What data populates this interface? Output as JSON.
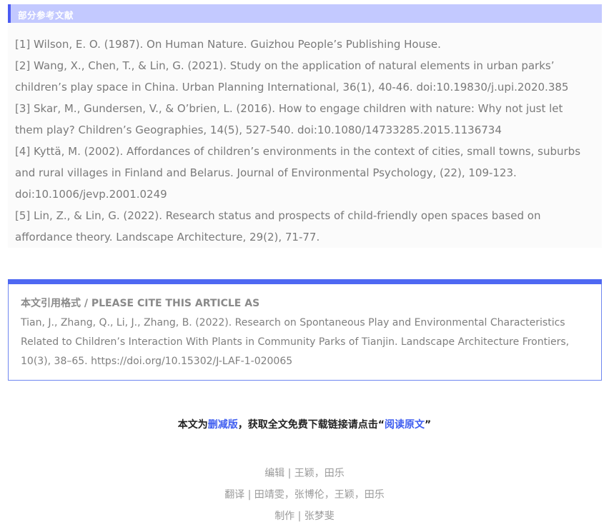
{
  "references": {
    "header": "部分参考文献",
    "items": [
      "[1] Wilson, E. O. (1987). On Human Nature. Guizhou People’s Publishing House.",
      "[2] Wang, X., Chen, T., & Lin, G. (2021). Study on the application of natural elements in urban parks’ children’s play space in China. Urban Planning International, 36(1), 40-46. doi:10.19830/j.upi.2020.385",
      "[3] Skar, M., Gundersen, V., & O’brien, L. (2016). How to engage children with nature: Why not just let them play? Children’s Geographies, 14(5), 527-540. doi:10.1080/14733285.2015.1136734",
      "[4] Kyttä, M. (2002). Affordances of children’s environments in the context of cities, small towns, suburbs and rural villages in Finland and Belarus. Journal of Environmental Psychology, (22), 109-123. doi:10.1006/jevp.2001.0249",
      "[5] Lin, Z., & Lin, G. (2022). Research status and prospects of child-friendly open spaces based on affordance theory. Landscape Architecture, 29(2), 71-77."
    ]
  },
  "citation": {
    "heading": "本文引用格式 / PLEASE CITE THIS ARTICLE AS",
    "text": "Tian, J., Zhang, Q., Li, J., Zhang, B. (2022). Research on Spontaneous Play and Environmental Characteristics Related to Children’s Interaction With Plants in Community Parks of Tianjin. Landscape Architecture Frontiers, 10(3), 38–65. https://doi.org/10.15302/J-LAF-1-020065"
  },
  "notice": {
    "prefix": "本文为",
    "abridged_link": "删减版",
    "middle": "，获取全文免费下载链接请点击“",
    "read_original_link": "阅读原文",
    "suffix": "”"
  },
  "credits": {
    "editor": "编辑 | 王颖，田乐",
    "translator": "翻译 | 田靖雯，张博伦，王颖，田乐",
    "producer": "制作 | 张梦斐"
  },
  "colors": {
    "accent": "#4e68f2",
    "header_bg": "#c3c9ff",
    "body_text": "#7a7a7a"
  }
}
